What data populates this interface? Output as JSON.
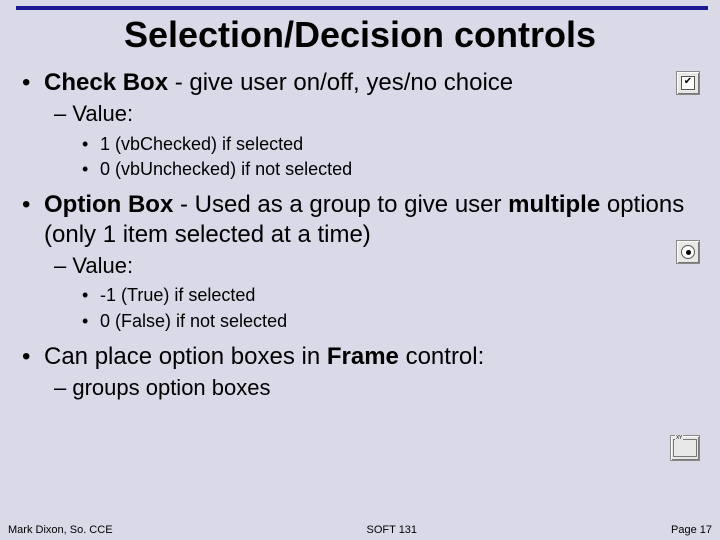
{
  "title": "Selection/Decision controls",
  "bullets": {
    "b1": {
      "prefix": "Check Box",
      "rest": " - give user on/off, yes/no choice"
    },
    "b1_sub": "– Value:",
    "b1_l3a": "1 (vbChecked) if selected",
    "b1_l3b": "0 (vbUnchecked) if not selected",
    "b2": {
      "prefix": "Option Box",
      "rest_a": " - Used as a group to give user ",
      "multi": "multiple",
      "rest_b": " options (only 1 item selected at a time)"
    },
    "b2_sub": "– Value:",
    "b2_l3a": "-1 (True) if selected",
    "b2_l3b": "0 (False) if not selected",
    "b3": {
      "a": "Can place option boxes in ",
      "frame": "Frame",
      "b": " control:"
    },
    "b3_sub": "– groups option boxes"
  },
  "footer": {
    "left": "Mark Dixon, So. CCE",
    "center": "SOFT 131",
    "right": "Page 17"
  }
}
